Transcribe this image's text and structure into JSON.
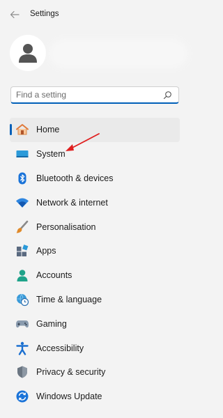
{
  "header": {
    "title": "Settings",
    "back_icon": "back-arrow-icon"
  },
  "profile": {
    "avatar_icon": "user-avatar-icon"
  },
  "search": {
    "placeholder": "Find a setting",
    "value": "",
    "icon": "search-icon"
  },
  "nav": {
    "selected": "Home",
    "items": [
      {
        "label": "Home",
        "icon": "home-icon"
      },
      {
        "label": "System",
        "icon": "system-icon"
      },
      {
        "label": "Bluetooth & devices",
        "icon": "bluetooth-icon"
      },
      {
        "label": "Network & internet",
        "icon": "wifi-icon"
      },
      {
        "label": "Personalisation",
        "icon": "paint-brush-icon"
      },
      {
        "label": "Apps",
        "icon": "apps-icon"
      },
      {
        "label": "Accounts",
        "icon": "accounts-icon"
      },
      {
        "label": "Time & language",
        "icon": "globe-clock-icon"
      },
      {
        "label": "Gaming",
        "icon": "gamepad-icon"
      },
      {
        "label": "Accessibility",
        "icon": "accessibility-icon"
      },
      {
        "label": "Privacy & security",
        "icon": "shield-icon"
      },
      {
        "label": "Windows Update",
        "icon": "update-icon"
      }
    ]
  },
  "annotation": {
    "type": "red-arrow",
    "points_to": "System",
    "color": "#e02020"
  },
  "colors": {
    "accent": "#005fb8",
    "background": "#f3f3f3",
    "selected_bg": "#eaeaea"
  }
}
